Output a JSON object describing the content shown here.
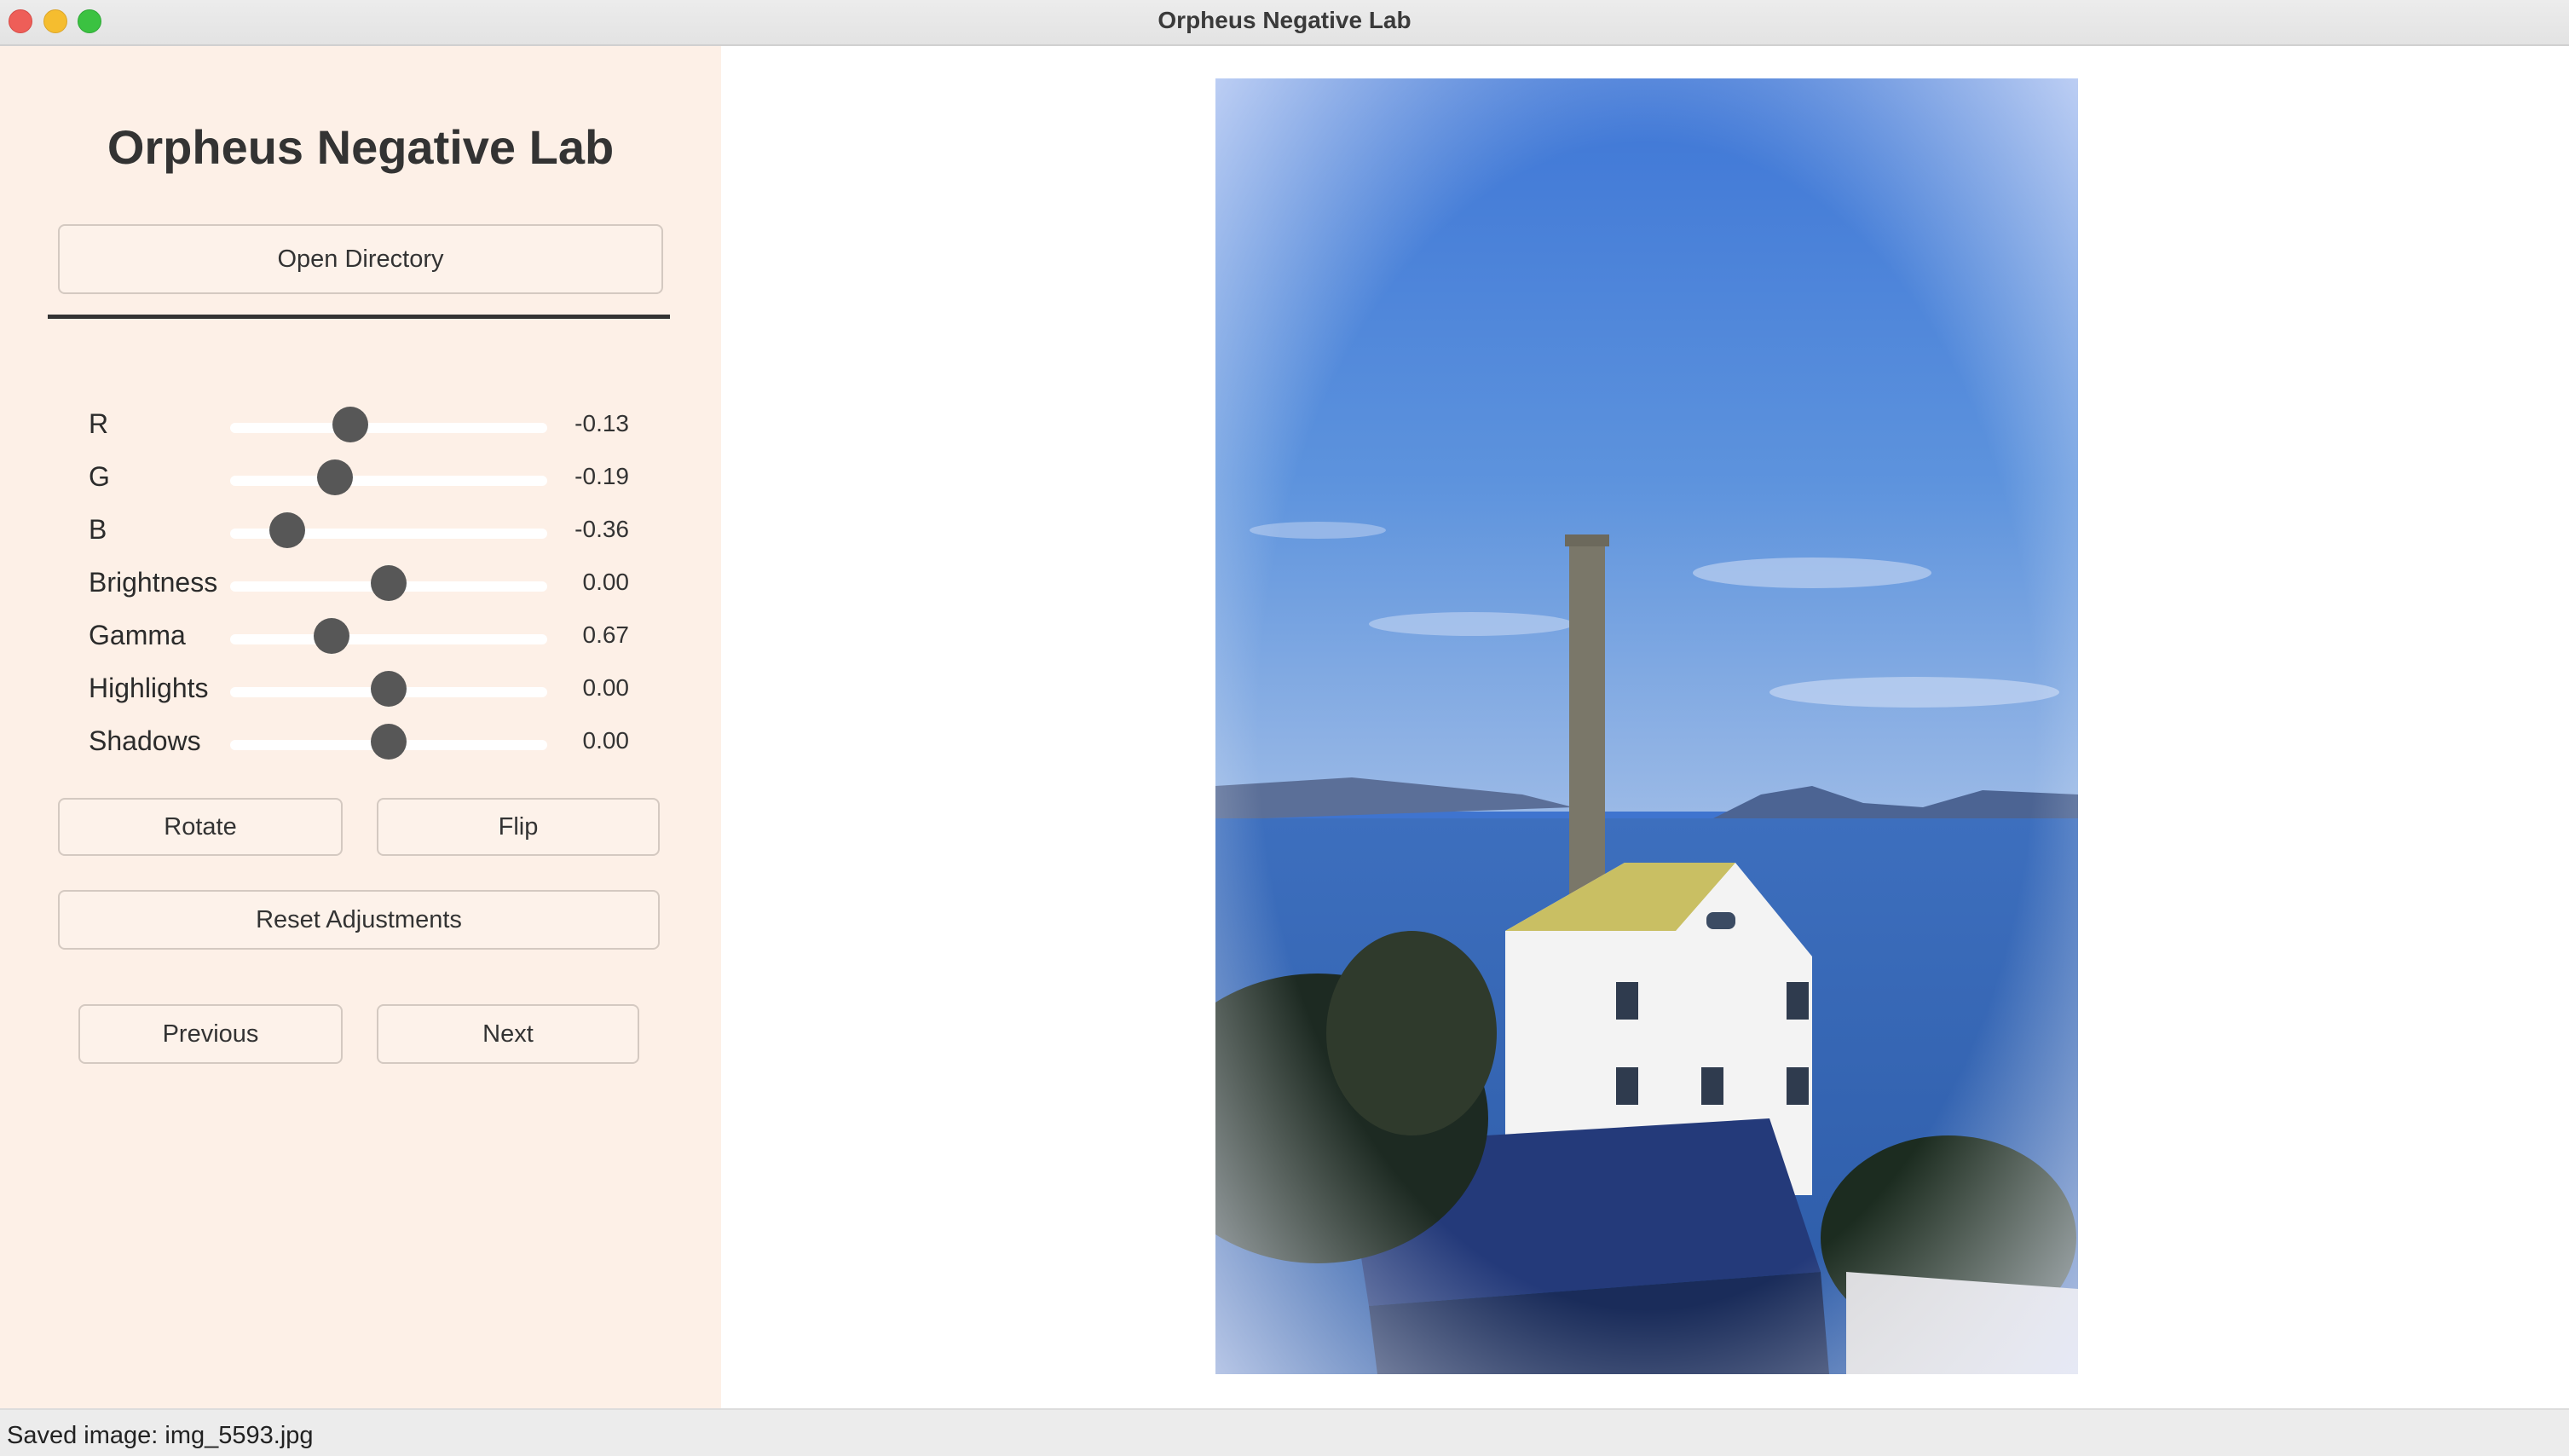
{
  "window": {
    "title": "Orpheus Negative Lab",
    "controls": [
      "close",
      "minimize",
      "maximize"
    ]
  },
  "sidebar": {
    "app_title": "Orpheus Negative Lab",
    "open_directory_label": "Open Directory",
    "sliders": [
      {
        "label": "R",
        "value": "-0.13",
        "position": 0.38
      },
      {
        "label": "G",
        "value": "-0.19",
        "position": 0.33
      },
      {
        "label": "B",
        "value": "-0.36",
        "position": 0.18
      },
      {
        "label": "Brightness",
        "value": "0.00",
        "position": 0.5
      },
      {
        "label": "Gamma",
        "value": "0.67",
        "position": 0.32
      },
      {
        "label": "Highlights",
        "value": "0.00",
        "position": 0.5
      },
      {
        "label": "Shadows",
        "value": "0.00",
        "position": 0.5
      }
    ],
    "rotate_label": "Rotate",
    "flip_label": "Flip",
    "reset_label": "Reset Adjustments",
    "previous_label": "Previous",
    "next_label": "Next"
  },
  "main": {
    "photo_subject": "film-scan-preview"
  },
  "status": {
    "text": "Saved image: img_5593.jpg"
  },
  "colors": {
    "sidebar_bg": "#fdf0e7",
    "slider_thumb": "#575757",
    "close": "#ee5e58",
    "minimize": "#f5bd2f",
    "maximize": "#3bc241"
  }
}
